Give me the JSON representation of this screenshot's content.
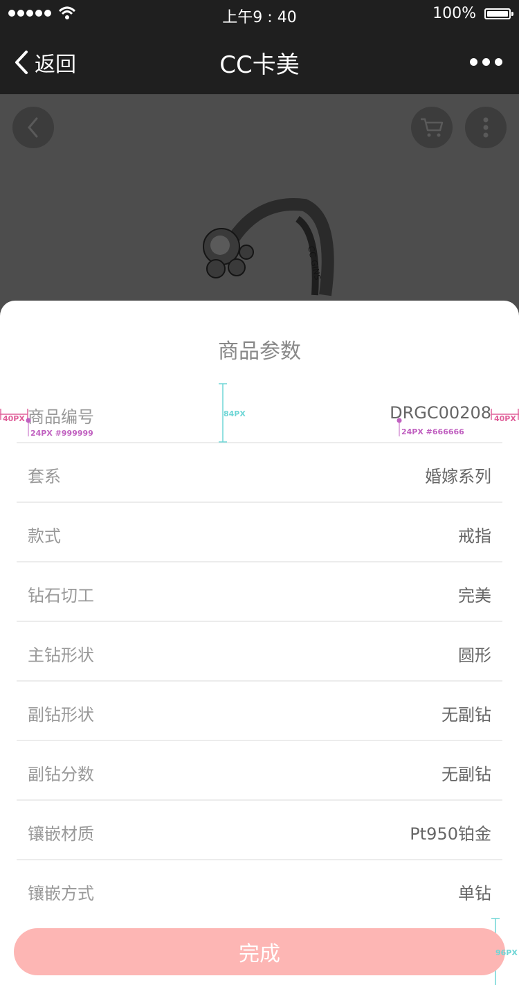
{
  "status_bar": {
    "time": "上午9 : 40",
    "battery": "100%"
  },
  "nav": {
    "back_label": "返回",
    "title": "CC卡美"
  },
  "hero": {
    "ring_engraving": "CC GINS"
  },
  "sheet": {
    "title": "商品参数",
    "rows": [
      {
        "label": "商品编号",
        "value": "DRGC00208"
      },
      {
        "label": "套系",
        "value": "婚嫁系列"
      },
      {
        "label": "款式",
        "value": "戒指"
      },
      {
        "label": "钻石切工",
        "value": "完美"
      },
      {
        "label": "主钻形状",
        "value": "圆形"
      },
      {
        "label": "副钻形状",
        "value": "无副钻"
      },
      {
        "label": "副钻分数",
        "value": "无副钻"
      },
      {
        "label": "镶嵌材质",
        "value": "Pt950铂金"
      },
      {
        "label": "镶嵌方式",
        "value": "单钻"
      }
    ],
    "done_label": "完成"
  },
  "annotations": {
    "margin_left": "40PX",
    "margin_right": "40PX",
    "row_height": "84PX",
    "label_spec": "24PX #999999",
    "value_spec": "24PX #666666",
    "button_height": "96PX"
  },
  "colors": {
    "bar_bg": "#1f1f1f",
    "hero_bg": "#4d4d4d",
    "label_text": "#999999",
    "value_text": "#666666",
    "button_bg": "#fdb6b4"
  }
}
